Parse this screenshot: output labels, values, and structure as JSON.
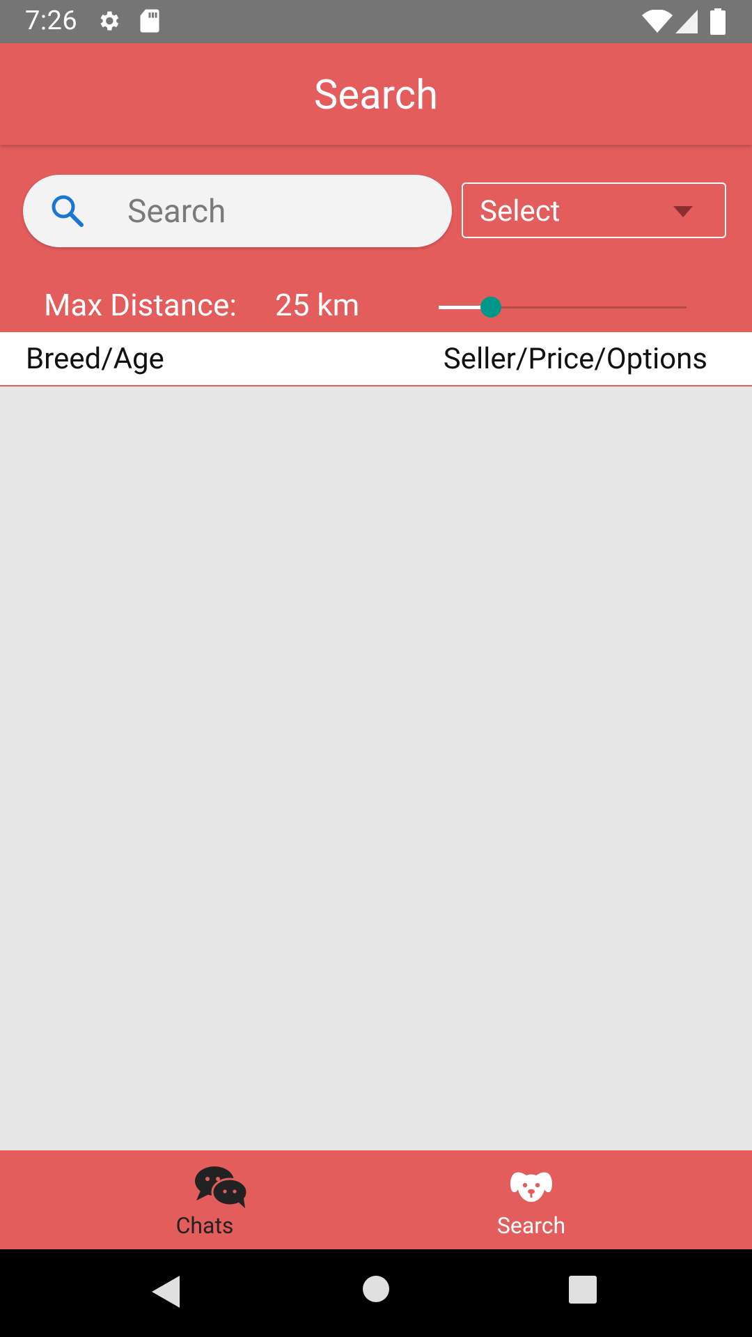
{
  "status_bar": {
    "time": "7:26",
    "icons": [
      "settings-icon",
      "sd-card-icon",
      "wifi-icon",
      "cell-signal-icon",
      "battery-icon"
    ]
  },
  "app_bar": {
    "title": "Search"
  },
  "filters": {
    "search_placeholder": "Search",
    "select_label": "Select",
    "max_distance_label": "Max Distance:",
    "distance_value": "25 km",
    "slider_fraction": 0.21
  },
  "table_header": {
    "left": "Breed/Age",
    "right": "Seller/Price/Options"
  },
  "bottom_nav": {
    "items": [
      {
        "label": "Chats",
        "icon": "chat-bubbles-icon",
        "active": true
      },
      {
        "label": "Search",
        "icon": "dog-face-icon",
        "active": false
      }
    ]
  },
  "colors": {
    "primary": "#e35d5d",
    "accent": "#009688",
    "search_icon": "#1976d2"
  }
}
